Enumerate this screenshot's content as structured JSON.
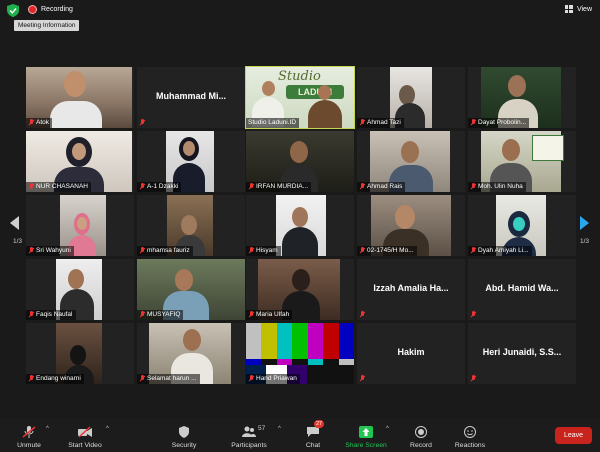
{
  "topbar": {
    "recording": "Recording",
    "tooltip": "Meeting Information",
    "view": "View"
  },
  "pager": {
    "left": "1/3",
    "right": "1/3"
  },
  "participants": [
    {
      "name": "Atok"
    },
    {
      "name": "Muhammad  Mi..."
    },
    {
      "name": "Studio Laduni.ID",
      "banner_title": "Studio",
      "banner_logo": "LADUNI"
    },
    {
      "name": "Ahmad Tazi"
    },
    {
      "name": "Dayat Probolin..."
    },
    {
      "name": "NUR CHASANAH"
    },
    {
      "name": "A-1 Dzakki"
    },
    {
      "name": "IRFAN MURDIA..."
    },
    {
      "name": "Ahmad Rais"
    },
    {
      "name": "Moh. Ulin Nuha"
    },
    {
      "name": "Sri Wahyuni"
    },
    {
      "name": "mhamsa fauriz"
    },
    {
      "name": "Hisyam"
    },
    {
      "name": "02-1745/H Mo..."
    },
    {
      "name": "Dyah Amiyah Li..."
    },
    {
      "name": "Faqis Naufal"
    },
    {
      "name": "MUSYAFIQ"
    },
    {
      "name": "Maria Ulfah"
    },
    {
      "name": "Izzah  Amalia  Ha..."
    },
    {
      "name": "Abd.  Hamid  Wa..."
    },
    {
      "name": "Endang winarni"
    },
    {
      "name": "Selamat harun ..."
    },
    {
      "name": "Hand  Priawan"
    },
    {
      "name": "Hakim"
    },
    {
      "name": "Heri  Junaidi,  S.S..."
    }
  ],
  "toolbar": {
    "unmute": "Unmute",
    "start_video": "Start Video",
    "security": "Security",
    "participants": "Participants",
    "participants_count": "57",
    "chat": "Chat",
    "chat_badge": "27",
    "share_screen": "Share Screen",
    "record": "Record",
    "reactions": "Reactions",
    "leave": "Leave"
  },
  "colors": {
    "share_green": "#23c552",
    "leave_red": "#c8231c",
    "active_outline": "#c7d64f",
    "nav_blue": "#2aa7ee"
  }
}
